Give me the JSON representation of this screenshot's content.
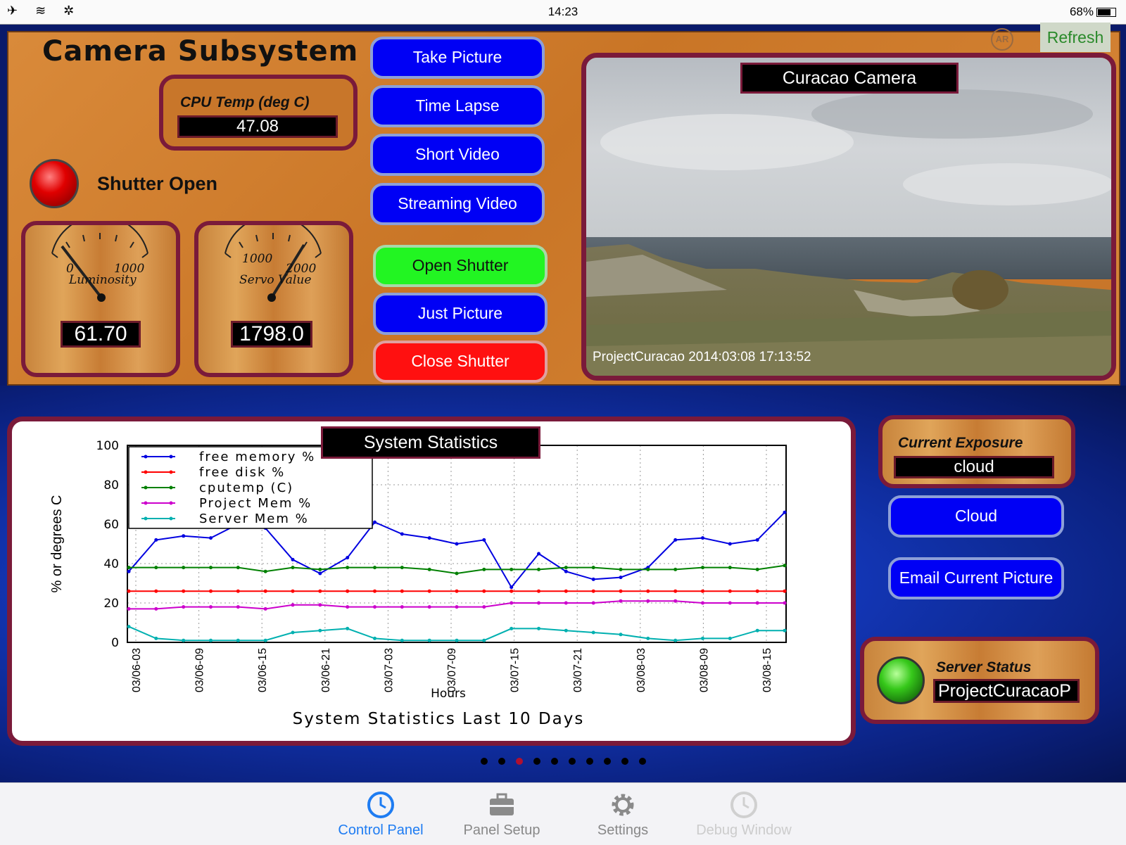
{
  "status_bar": {
    "time": "14:23",
    "battery": "68%"
  },
  "header": {
    "title": "Camera Subsystem",
    "ar_label": "AR",
    "refresh_label": "Refresh"
  },
  "cpu_temp": {
    "label": "CPU Temp (deg C)",
    "value": "47.08"
  },
  "shutter": {
    "label": "Shutter Open"
  },
  "luminosity_gauge": {
    "min": "0",
    "max": "1000",
    "label": "Luminosity",
    "value": "61.70"
  },
  "servo_gauge": {
    "min": "1000",
    "max": "2000",
    "label": "Servo Value",
    "value": "1798.0"
  },
  "buttons": {
    "take_picture": "Take Picture",
    "time_lapse": "Time Lapse",
    "short_video": "Short Video",
    "streaming_video": "Streaming Video",
    "open_shutter": "Open Shutter",
    "just_picture": "Just Picture",
    "close_shutter": "Close Shutter",
    "cloud": "Cloud",
    "email_picture": "Email Current Picture"
  },
  "camera": {
    "title": "Curacao Camera",
    "caption": "ProjectCuracao 2014:03:08 17:13:52"
  },
  "exposure": {
    "label": "Current Exposure",
    "value": "cloud"
  },
  "server": {
    "label": "Server Status",
    "value": "ProjectCuracaoP"
  },
  "chart_panel": {
    "badge": "System Statistics"
  },
  "chart_data": {
    "type": "line",
    "title": "System Statistics Last 10 Days",
    "xlabel": "Hours",
    "ylabel": "% or degrees C",
    "ylim": [
      0,
      100
    ],
    "yticks": [
      0,
      20,
      40,
      60,
      80,
      100
    ],
    "categories": [
      "03/06-03",
      "03/06-09",
      "03/06-15",
      "03/06-21",
      "03/07-03",
      "03/07-09",
      "03/07-15",
      "03/07-21",
      "03/08-03",
      "03/08-09",
      "03/08-15"
    ],
    "grid": true,
    "legend_position": "top-left",
    "series": [
      {
        "name": "free memory %",
        "color": "#0000e0",
        "values": [
          36,
          52,
          54,
          53,
          60,
          58,
          42,
          35,
          43,
          61,
          55,
          53,
          50,
          52,
          28,
          45,
          36,
          32,
          33,
          38,
          52,
          53,
          50,
          52,
          66
        ]
      },
      {
        "name": "free disk %",
        "color": "#ff0000",
        "values": [
          26,
          26,
          26,
          26,
          26,
          26,
          26,
          26,
          26,
          26,
          26,
          26,
          26,
          26,
          26,
          26,
          26,
          26,
          26,
          26,
          26,
          26,
          26,
          26,
          26
        ]
      },
      {
        "name": "cputemp (C)",
        "color": "#008000",
        "values": [
          38,
          38,
          38,
          38,
          38,
          36,
          38,
          37,
          38,
          38,
          38,
          37,
          35,
          37,
          37,
          37,
          38,
          38,
          37,
          37,
          37,
          38,
          38,
          37,
          39
        ]
      },
      {
        "name": "Project Mem %",
        "color": "#cc00cc",
        "values": [
          17,
          17,
          18,
          18,
          18,
          17,
          19,
          19,
          18,
          18,
          18,
          18,
          18,
          18,
          20,
          20,
          20,
          20,
          21,
          21,
          21,
          20,
          20,
          20,
          20
        ]
      },
      {
        "name": "Server Mem %",
        "color": "#00b0b0",
        "values": [
          8,
          2,
          1,
          1,
          1,
          1,
          5,
          6,
          7,
          2,
          1,
          1,
          1,
          1,
          7,
          7,
          6,
          5,
          4,
          2,
          1,
          2,
          2,
          6,
          6
        ]
      }
    ]
  },
  "page_dots": {
    "count": 10,
    "active": 2
  },
  "tabs": [
    {
      "label": "Control Panel",
      "icon": "clock-icon",
      "state": "active"
    },
    {
      "label": "Panel Setup",
      "icon": "toolbox-icon",
      "state": "normal"
    },
    {
      "label": "Settings",
      "icon": "gear-icon",
      "state": "normal"
    },
    {
      "label": "Debug Window",
      "icon": "clock-icon",
      "state": "disabled"
    }
  ]
}
